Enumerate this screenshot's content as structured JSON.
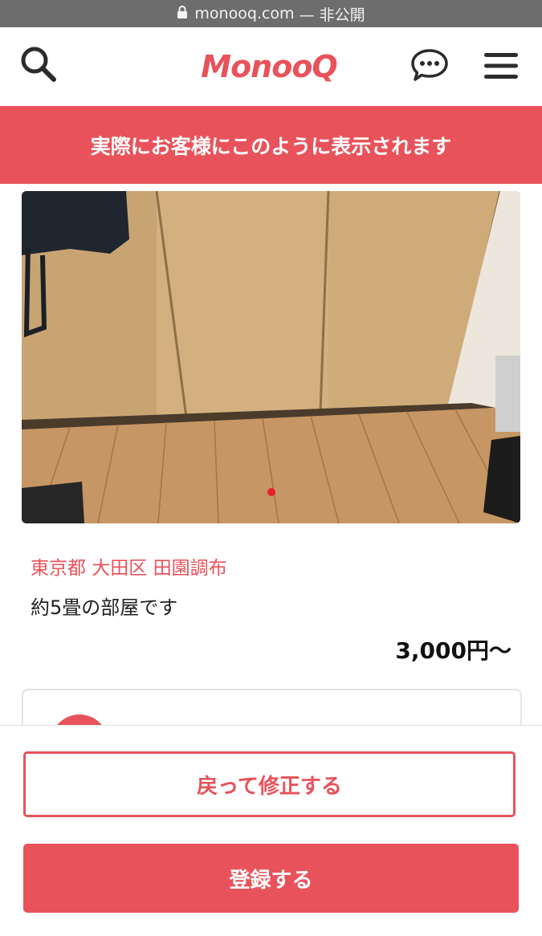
{
  "browser": {
    "url": "monooq.com",
    "suffix": "— 非公開"
  },
  "header": {
    "logo_text": "MonooQ"
  },
  "banner": {
    "text": "実際にお客様にこのように表示されます"
  },
  "listing": {
    "location": "東京都 大田区 田園調布",
    "description": "約5畳の部屋です",
    "price": "3,000円〜"
  },
  "actions": {
    "back_label": "戻って修正する",
    "register_label": "登録する"
  },
  "colors": {
    "accent": "#e8535b",
    "urlbar": "#6d6d6d"
  }
}
